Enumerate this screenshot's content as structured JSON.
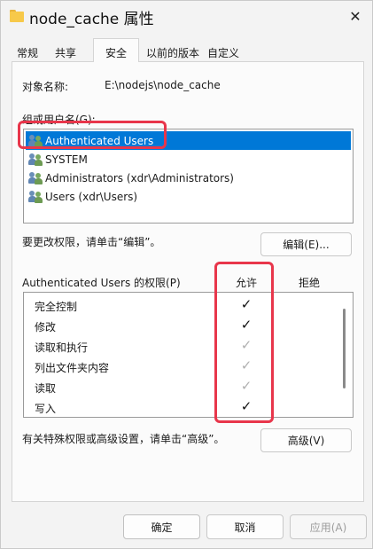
{
  "window": {
    "title": "node_cache 属性"
  },
  "tabs": [
    {
      "label": "常规",
      "active": false
    },
    {
      "label": "共享",
      "active": false
    },
    {
      "label": "安全",
      "active": true
    },
    {
      "label": "以前的版本",
      "active": false
    },
    {
      "label": "自定义",
      "active": false
    }
  ],
  "security": {
    "object_name_label": "对象名称:",
    "object_name_value": "E:\\nodejs\\node_cache",
    "group_label": "组或用户名(G):",
    "users": [
      {
        "name": "Authenticated Users",
        "selected": true,
        "icon": "users-group-icon"
      },
      {
        "name": "SYSTEM",
        "selected": false,
        "icon": "users-group-icon"
      },
      {
        "name": "Administrators (xdr\\Administrators)",
        "selected": false,
        "icon": "users-group-icon"
      },
      {
        "name": "Users (xdr\\Users)",
        "selected": false,
        "icon": "users-group-icon"
      }
    ],
    "edit_hint": "要更改权限，请单击“编辑”。",
    "edit_button": "编辑(E)...",
    "perm_title": "Authenticated Users 的权限(P)",
    "allow_col": "允许",
    "deny_col": "拒绝",
    "permissions": [
      {
        "name": "完全控制",
        "allow": "checked"
      },
      {
        "name": "修改",
        "allow": "checked"
      },
      {
        "name": "读取和执行",
        "allow": "inherited"
      },
      {
        "name": "列出文件夹内容",
        "allow": "inherited"
      },
      {
        "name": "读取",
        "allow": "inherited"
      },
      {
        "name": "写入",
        "allow": "checked"
      }
    ],
    "check_glyph": "✓",
    "advanced_hint": "有关特殊权限或高级设置，请单击“高级”。",
    "advanced_button": "高级(V)"
  },
  "footer": {
    "ok": "确定",
    "cancel": "取消",
    "apply": "应用(A)"
  },
  "colors": {
    "selection": "#0078d7",
    "highlight": "#e8364b"
  }
}
